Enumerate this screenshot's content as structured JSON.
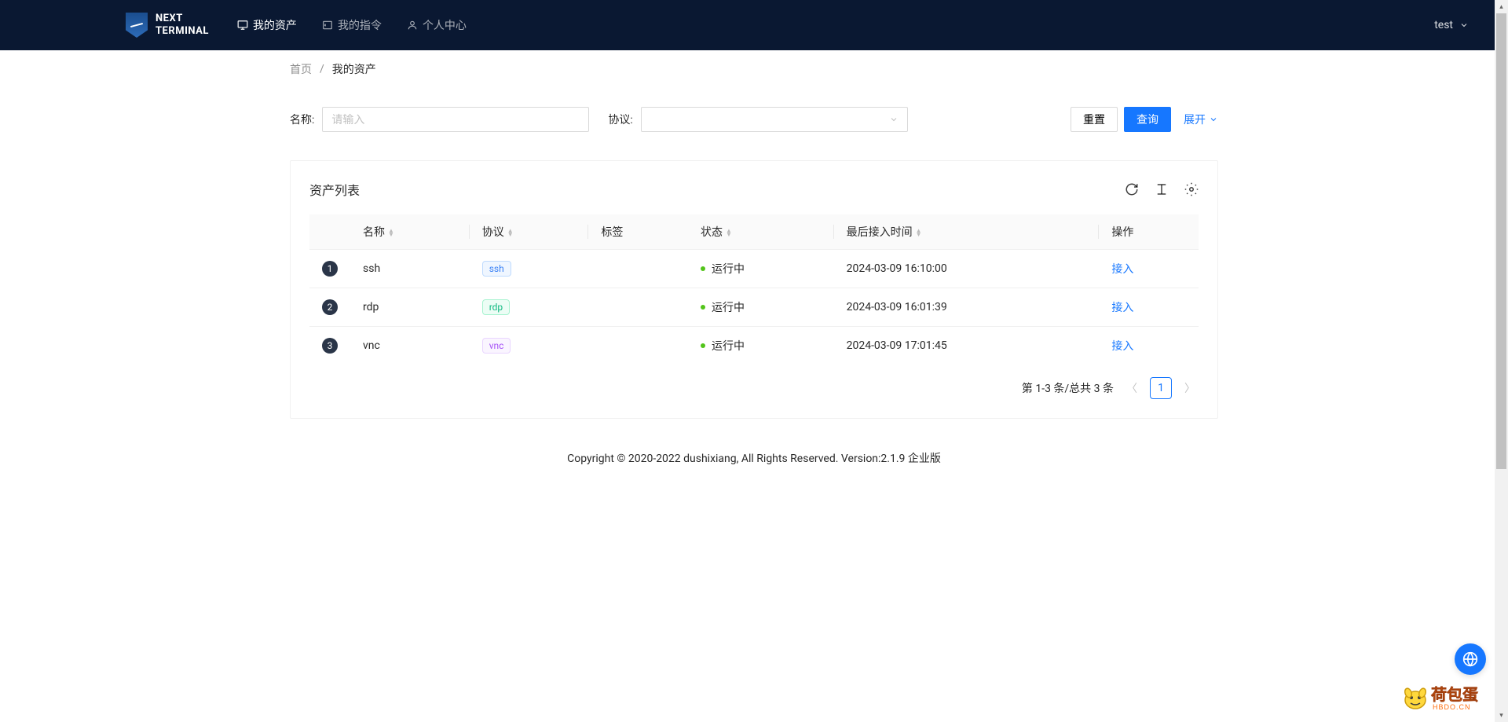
{
  "header": {
    "logo_text": "NEXT\nTERMINAL",
    "nav": [
      {
        "label": "我的资产",
        "icon": "desktop"
      },
      {
        "label": "我的指令",
        "icon": "code"
      },
      {
        "label": "个人中心",
        "icon": "user"
      }
    ],
    "user": {
      "name": "test"
    }
  },
  "breadcrumb": {
    "home": "首页",
    "current": "我的资产"
  },
  "filters": {
    "name_label": "名称:",
    "name_placeholder": "请输入",
    "protocol_label": "协议:",
    "reset": "重置",
    "query": "查询",
    "expand": "展开"
  },
  "table": {
    "title": "资产列表",
    "columns": {
      "name": "名称",
      "protocol": "协议",
      "tags": "标签",
      "status": "状态",
      "last_access": "最后接入时间",
      "action": "操作"
    },
    "rows": [
      {
        "idx": "1",
        "name": "ssh",
        "protocol": "ssh",
        "protocol_class": "tag-ssh",
        "status": "运行中",
        "time": "2024-03-09 16:10:00",
        "action": "接入"
      },
      {
        "idx": "2",
        "name": "rdp",
        "protocol": "rdp",
        "protocol_class": "tag-rdp",
        "status": "运行中",
        "time": "2024-03-09 16:01:39",
        "action": "接入"
      },
      {
        "idx": "3",
        "name": "vnc",
        "protocol": "vnc",
        "protocol_class": "tag-vnc",
        "status": "运行中",
        "time": "2024-03-09 17:01:45",
        "action": "接入"
      }
    ]
  },
  "pagination": {
    "summary": "第 1-3 条/总共 3 条",
    "current": "1"
  },
  "footer": {
    "text": "Copyright © 2020-2022 dushixiang, All Rights Reserved. Version:2.1.9 企业版"
  }
}
